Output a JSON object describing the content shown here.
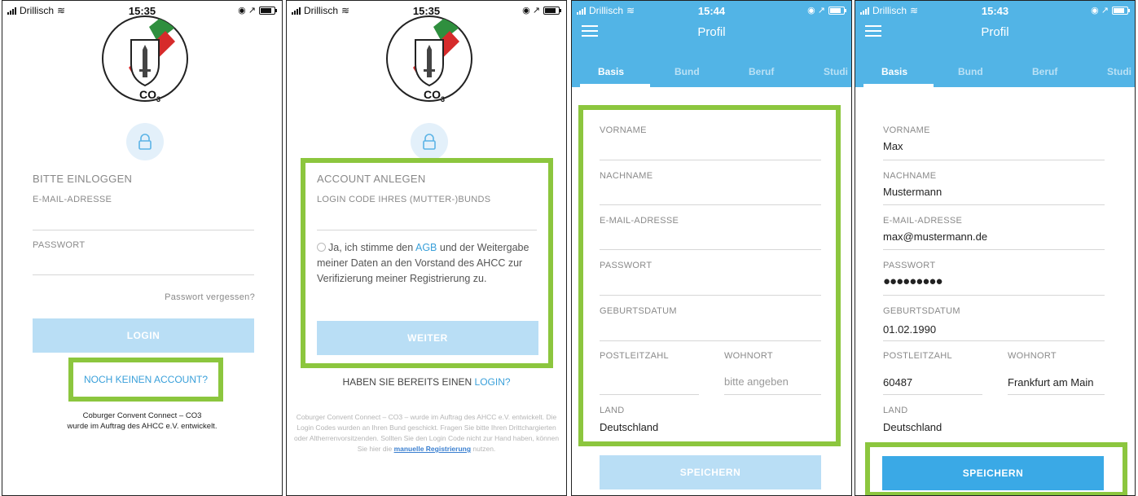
{
  "status_bars": [
    {
      "carrier": "Drillisch",
      "time": "15:35",
      "right": "◉ ↗"
    },
    {
      "carrier": "Drillisch",
      "time": "15:35",
      "right": "◉ ↗"
    },
    {
      "carrier": "Drillisch",
      "time": "15:44",
      "right": "◉ ↗"
    },
    {
      "carrier": "Drillisch",
      "time": "15:43",
      "right": "◉ ↗"
    }
  ],
  "logo": {
    "text": "CO",
    "subscript": "3",
    "colors": {
      "green": "#2f8f3e",
      "red": "#d62b2b"
    }
  },
  "login": {
    "title": "BITTE EINLOGGEN",
    "email_label": "E-MAIL-ADRESSE",
    "password_label": "PASSWORT",
    "forgot": "Passwort vergessen?",
    "login_button": "LOGIN",
    "no_account_link": "NOCH KEINEN ACCOUNT?",
    "footer_line1": "Coburger Convent Connect – CO3",
    "footer_line2": "wurde im Auftrag des AHCC e.V. entwickelt."
  },
  "register": {
    "title": "ACCOUNT ANLEGEN",
    "code_label": "LOGIN CODE IHRES (MUTTER-)BUNDS",
    "consent_pre": "Ja, ich stimme den ",
    "consent_link": "AGB",
    "consent_post": " und der Weitergabe meiner Daten an den Vorstand des AHCC zur Verifizierung meiner Registrierung zu.",
    "next_button": "WEITER",
    "have_account_pre": "HABEN SIE BEREITS EINEN ",
    "have_account_link": "LOGIN?",
    "footer_text": "Coburger Convent Connect – CO3 – wurde im Auftrag des AHCC e.V. entwickelt. Die Login Codes wurden an Ihren Bund geschickt. Fragen Sie bitte Ihren Drittchargierten oder Altherrenvorsitzenden. Sollten Sie den Login Code nicht zur Hand haben, können Sie hier die ",
    "footer_link": "manuelle Registrierung",
    "footer_end": " nutzen."
  },
  "profile": {
    "title": "Profil",
    "tabs": [
      "Basis",
      "Bund",
      "Beruf",
      "Studi"
    ],
    "labels": {
      "firstname": "VORNAME",
      "lastname": "NACHNAME",
      "email": "E-MAIL-ADRESSE",
      "password": "PASSWORT",
      "birthdate": "GEBURTSDATUM",
      "zip": "POSTLEITZAHL",
      "city": "WOHNORT",
      "country": "LAND"
    },
    "city_placeholder": "bitte angeben",
    "empty_country": "Deutschland",
    "save_button": "SPEICHERN",
    "filled": {
      "firstname": "Max",
      "lastname": "Mustermann",
      "email": "max@mustermann.de",
      "password": "●●●●●●●●●",
      "birthdate": "01.02.1990",
      "zip": "60487",
      "city": "Frankfurt am Main",
      "country": "Deutschland"
    }
  },
  "colors": {
    "accent": "#52b4e6",
    "button_disabled": "#b9def5",
    "highlight": "#8cc63e",
    "link": "#3aa0da"
  }
}
